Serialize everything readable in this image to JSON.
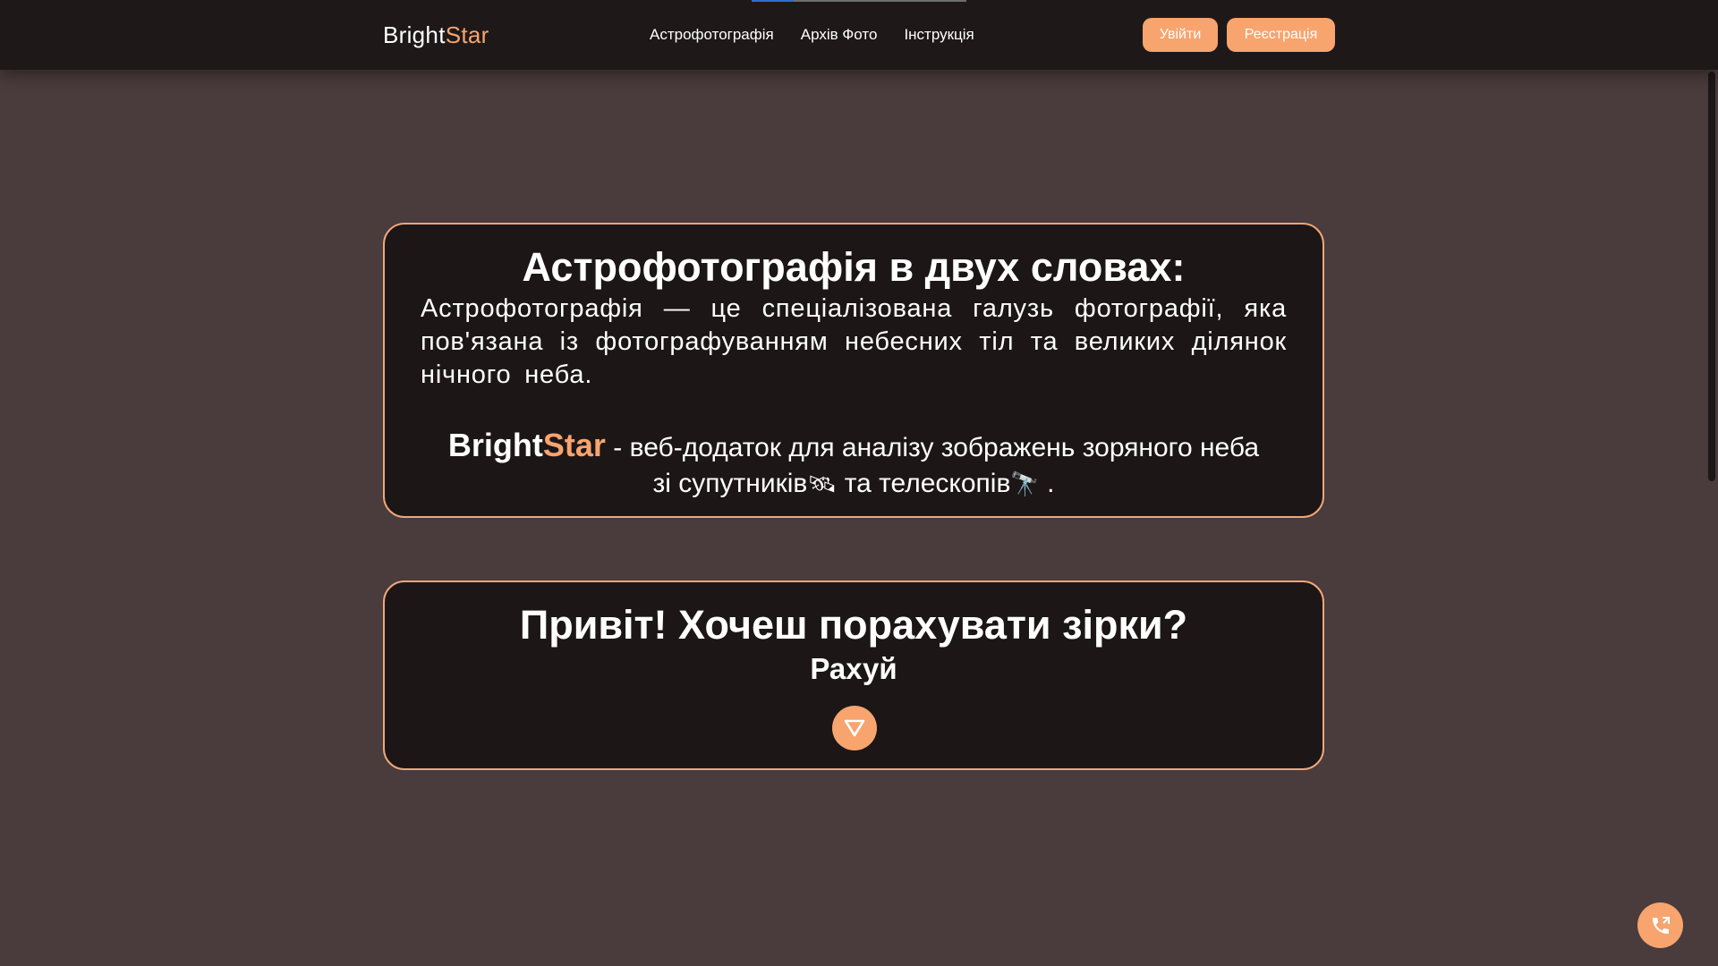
{
  "header": {
    "logo_part1": "Bright",
    "logo_part2": "Star",
    "nav": [
      "Астрофотографія",
      "Архів Фото",
      "Інструкція"
    ],
    "login_label": "Увійти",
    "register_label": "Реєстрація"
  },
  "intro_card": {
    "title": "Астрофотографія в двух словах:",
    "text": "Астрофотографія — це спеціалізована галузь фотографії, яка пов'язана із фотографуванням небесних тіл та великих ділянок нічного неба.",
    "brand_part1": "Bright",
    "brand_part2": "Star",
    "description_start": " - веб-додаток для аналізу зображень зоряного неба зі супутників",
    "satellite_emoji": "🛰",
    "description_mid": " та телескопів",
    "telescope_emoji": "🔭",
    "description_end": " ."
  },
  "count_card": {
    "title": "Привіт! Хочеш порахувати зірки?",
    "subtitle": "Рахуй"
  },
  "icons": {
    "down": "triangle-down-icon",
    "phone": "phone-icon"
  },
  "colors": {
    "accent": "#f7a46e",
    "background": "#4a3b3c",
    "card": "#1c1617",
    "header": "#1e1819",
    "card_border": "#f0a779"
  }
}
